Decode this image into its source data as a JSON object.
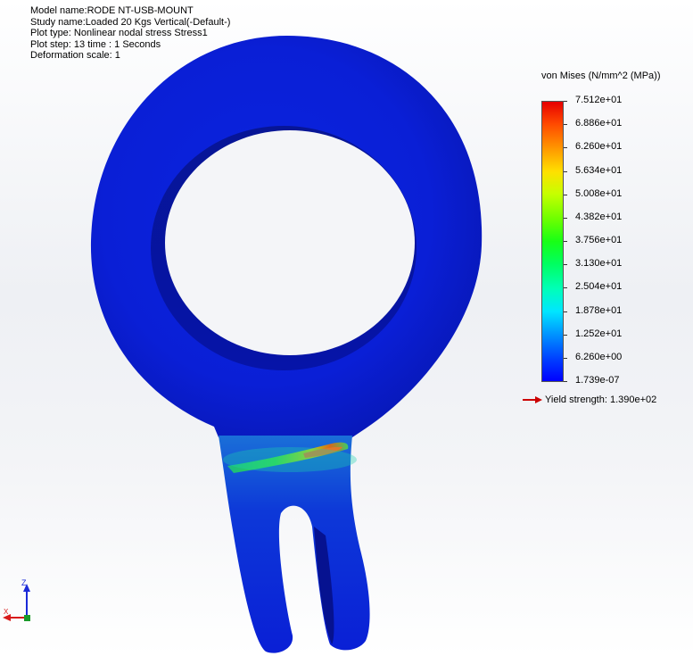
{
  "info": {
    "model_name": "Model name:RODE NT-USB-MOUNT",
    "study_name": "Study name:Loaded 20 Kgs Vertical(-Default-)",
    "plot_type": "Plot type: Nonlinear nodal stress Stress1",
    "plot_step": "Plot step: 13   time : 1 Seconds",
    "deformation_scale": "Deformation scale: 1"
  },
  "legend": {
    "title": "von Mises (N/mm^2 (MPa))",
    "labels": [
      "7.512e+01",
      "6.886e+01",
      "6.260e+01",
      "5.634e+01",
      "5.008e+01",
      "4.382e+01",
      "3.756e+01",
      "3.130e+01",
      "2.504e+01",
      "1.878e+01",
      "1.252e+01",
      "6.260e+00",
      "1.739e-07"
    ],
    "yield": "Yield strength: 1.390e+02"
  },
  "triad": {
    "z_label": "Z",
    "x_label": "X"
  },
  "colors": {
    "part_blue": "#0a1fd6",
    "part_dark": "#061290",
    "yield_arrow": "#cc0000"
  }
}
